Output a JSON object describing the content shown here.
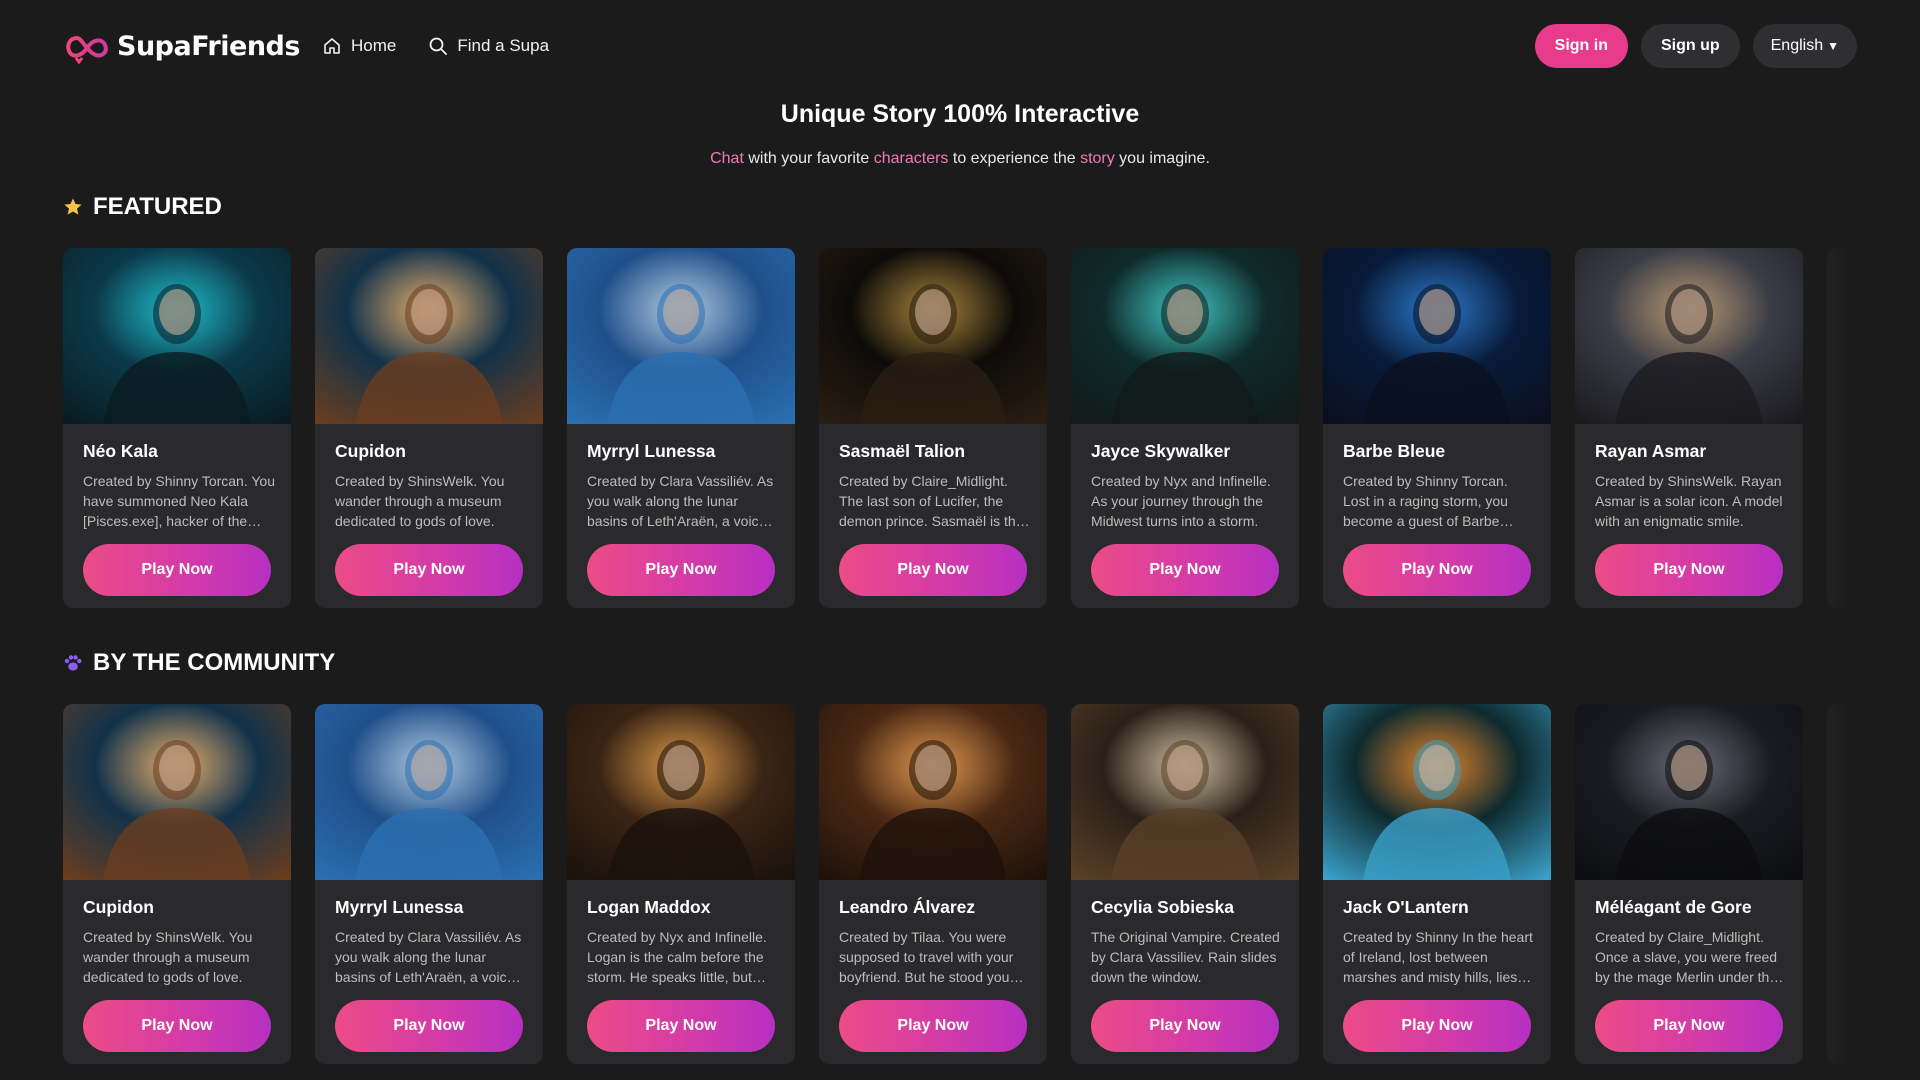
{
  "header": {
    "logo_text": "SupaFriends",
    "nav": [
      {
        "label": "Home",
        "icon": "home-icon"
      },
      {
        "label": "Find a Supa",
        "icon": "search-icon"
      }
    ],
    "signin_label": "Sign in",
    "signup_label": "Sign up",
    "language_label": "English",
    "caret": "▼"
  },
  "hero": {
    "title": "Unique Story 100% Interactive",
    "sub_word1": "Chat",
    "sub_text1": " with your favorite ",
    "sub_word2": "characters",
    "sub_text2": " to experience the ",
    "sub_word3": "story",
    "sub_text3": " you imagine."
  },
  "colors": {
    "accent": "#e83b8b",
    "background": "#1b1b1c",
    "card": "#2a2a2c",
    "highlight": "#f07bb6"
  },
  "sections": [
    {
      "title": "FEATURED",
      "icon": "star-icon",
      "cards": [
        {
          "name": "Néo Kala",
          "desc": "Created by Shinny Torcan. You have summoned Neo Kala [Pisces.exe], hacker of the digital seas.",
          "button": "Play Now"
        },
        {
          "name": "Cupidon",
          "desc": "Created by ShinsWelk. You wander through a museum dedicated to gods of love.",
          "button": "Play Now"
        },
        {
          "name": "Myrryl Lunessa",
          "desc": "Created by Clara Vassiliév. As you walk along the lunar basins of Leth'Araën, a voice calls.",
          "button": "Play Now"
        },
        {
          "name": "Sasmaël Talion",
          "desc": "Created by Claire_Midlight. The last son of Lucifer, the demon prince. Sasmaël is the one.",
          "button": "Play Now"
        },
        {
          "name": "Jayce Skywalker",
          "desc": "Created by Nyx and Infinelle. As your journey through the Midwest turns into a storm.",
          "button": "Play Now"
        },
        {
          "name": "Barbe Bleue",
          "desc": "Created by Shinny Torcan. Lost in a raging storm, you become a guest of Barbe Bleue.",
          "button": "Play Now"
        },
        {
          "name": "Rayan Asmar",
          "desc": "Created by ShinsWelk. Rayan Asmar is a solar icon. A model with an enigmatic smile.",
          "button": "Play Now"
        }
      ]
    },
    {
      "title": "BY THE COMMUNITY",
      "icon": "paw-icon",
      "cards": [
        {
          "name": "Cupidon",
          "desc": "Created by ShinsWelk. You wander through a museum dedicated to gods of love.",
          "button": "Play Now"
        },
        {
          "name": "Myrryl Lunessa",
          "desc": "Created by Clara Vassiliév. As you walk along the lunar basins of Leth'Araën, a voice calls.",
          "button": "Play Now"
        },
        {
          "name": "Logan Maddox",
          "desc": "Created by Nyx and Infinelle. Logan is the calm before the storm. He speaks little, but watches.",
          "button": "Play Now"
        },
        {
          "name": "Leandro Álvarez",
          "desc": "Created by Tilaa. You were supposed to travel with your boyfriend. But he stood you up.",
          "button": "Play Now"
        },
        {
          "name": "Cecylia Sobieska",
          "desc": "The Original Vampire. Created by Clara Vassiliev. Rain slides down the window.",
          "button": "Play Now"
        },
        {
          "name": "Jack O'Lantern",
          "desc": "Created by Shinny In the heart of Ireland, lost between marshes and misty hills, lies a town.",
          "button": "Play Now"
        },
        {
          "name": "Méléagant de Gore",
          "desc": "Created by Claire_Midlight. Once a slave, you were freed by the mage Merlin under the moon.",
          "button": "Play Now"
        }
      ]
    }
  ]
}
